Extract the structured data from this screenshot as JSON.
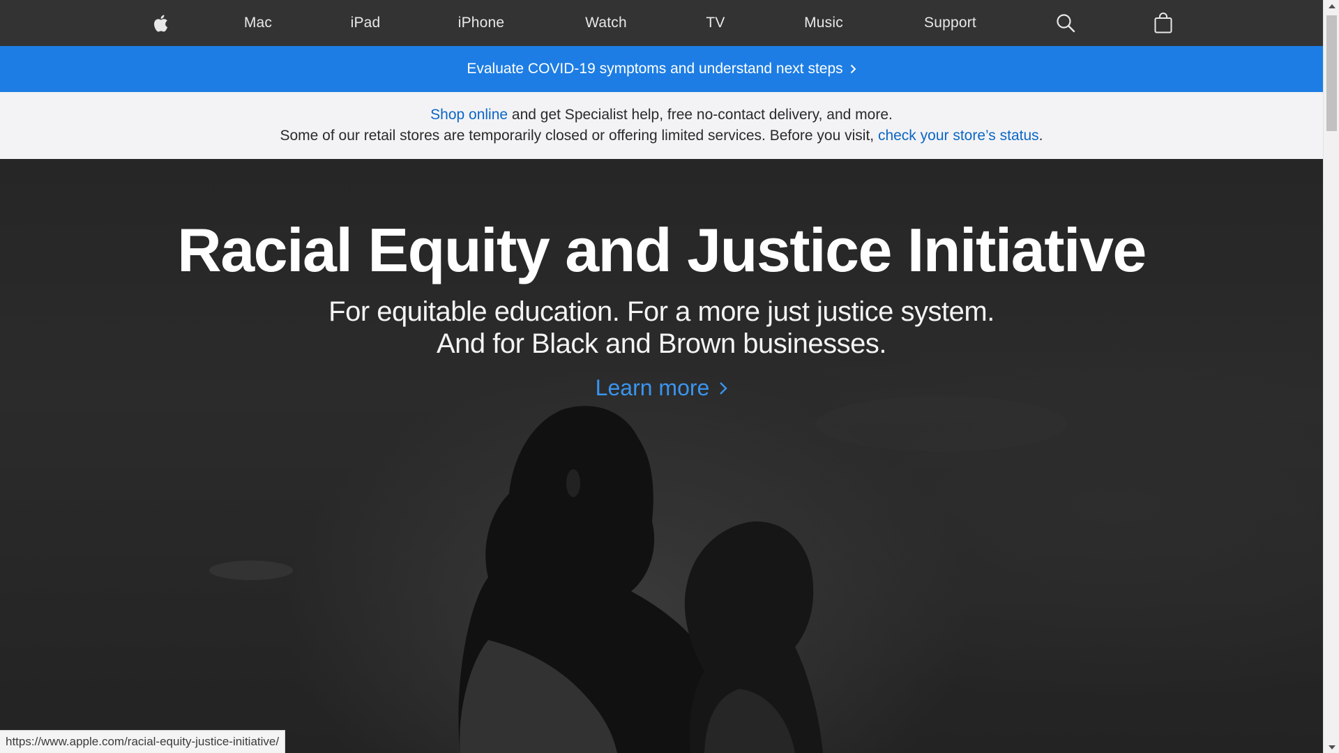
{
  "globalnav": {
    "items": [
      {
        "label": "Mac"
      },
      {
        "label": "iPad"
      },
      {
        "label": "iPhone"
      },
      {
        "label": "Watch"
      },
      {
        "label": "TV"
      },
      {
        "label": "Music"
      },
      {
        "label": "Support"
      }
    ],
    "icons": [
      "apple-logo-icon",
      "search-icon",
      "bag-icon"
    ]
  },
  "ribbon": {
    "text": "Evaluate COVID-19 symptoms and understand next steps"
  },
  "notice": {
    "line1_link": "Shop online",
    "line1_rest": " and get Specialist help, free no-contact delivery, and more.",
    "line2_text": "Some of our retail stores are temporarily closed or offering limited services. Before you visit, ",
    "line2_link": "check your store’s status",
    "line2_end": "."
  },
  "hero": {
    "title": "Racial Equity and Justice Initiative",
    "subtitle_line1": "For equitable education. For a more just justice system.",
    "subtitle_line2": "And for Black and Brown businesses.",
    "link": "Learn more"
  },
  "statusbar": {
    "url": "https://www.apple.com/racial-equity-justice-initiative/"
  },
  "colors": {
    "nav_bg": "#333333",
    "ribbon_bg": "#1d7de4",
    "notice_bg": "#f3f3f5",
    "link": "#0b66c5",
    "hero_link": "#3a95ef"
  }
}
